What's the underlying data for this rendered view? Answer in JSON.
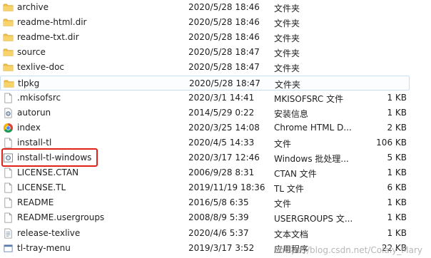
{
  "colors": {
    "folder": "#f0c04a",
    "highlight_border": "#e0211a",
    "selected_border": "#c9dff5"
  },
  "files": [
    {
      "name": "archive",
      "date": "2020/5/28 18:46",
      "type": "文件夹",
      "size": "",
      "icon": "folder-icon"
    },
    {
      "name": "readme-html.dir",
      "date": "2020/5/28 18:46",
      "type": "文件夹",
      "size": "",
      "icon": "folder-icon"
    },
    {
      "name": "readme-txt.dir",
      "date": "2020/5/28 18:46",
      "type": "文件夹",
      "size": "",
      "icon": "folder-icon"
    },
    {
      "name": "source",
      "date": "2020/5/28 18:47",
      "type": "文件夹",
      "size": "",
      "icon": "folder-icon"
    },
    {
      "name": "texlive-doc",
      "date": "2020/5/28 18:47",
      "type": "文件夹",
      "size": "",
      "icon": "folder-icon"
    },
    {
      "name": "tlpkg",
      "date": "2020/5/28 18:47",
      "type": "文件夹",
      "size": "",
      "icon": "folder-icon"
    },
    {
      "name": ".mkisofsrc",
      "date": "2020/3/1 14:41",
      "type": "MKISOFSRC 文件",
      "size": "1 KB",
      "icon": "file-icon"
    },
    {
      "name": "autorun",
      "date": "2014/5/29 0:22",
      "type": "安装信息",
      "size": "1 KB",
      "icon": "settings-file-icon"
    },
    {
      "name": "index",
      "date": "2020/3/25 14:08",
      "type": "Chrome HTML D...",
      "size": "2 KB",
      "icon": "chrome-icon"
    },
    {
      "name": "install-tl",
      "date": "2020/4/5 14:33",
      "type": "文件",
      "size": "106 KB",
      "icon": "file-icon"
    },
    {
      "name": "install-tl-windows",
      "date": "2020/3/17 12:46",
      "type": "Windows 批处理...",
      "size": "5 KB",
      "icon": "batch-file-icon"
    },
    {
      "name": "LICENSE.CTAN",
      "date": "2006/9/28 8:31",
      "type": "CTAN 文件",
      "size": "1 KB",
      "icon": "file-icon"
    },
    {
      "name": "LICENSE.TL",
      "date": "2019/11/19 18:36",
      "type": "TL 文件",
      "size": "6 KB",
      "icon": "file-icon"
    },
    {
      "name": "README",
      "date": "2016/5/8 6:35",
      "type": "文件",
      "size": "1 KB",
      "icon": "file-icon"
    },
    {
      "name": "README.usergroups",
      "date": "2008/8/9 5:39",
      "type": "USERGROUPS 文...",
      "size": "1 KB",
      "icon": "file-icon"
    },
    {
      "name": "release-texlive",
      "date": "2020/4/6 5:37",
      "type": "文本文档",
      "size": "1 KB",
      "icon": "text-file-icon"
    },
    {
      "name": "tl-tray-menu",
      "date": "2019/3/17 3:52",
      "type": "应用程序",
      "size": "22 KB",
      "icon": "app-icon"
    }
  ],
  "watermark": "https://blog.csdn.net/Colaly_Mary"
}
